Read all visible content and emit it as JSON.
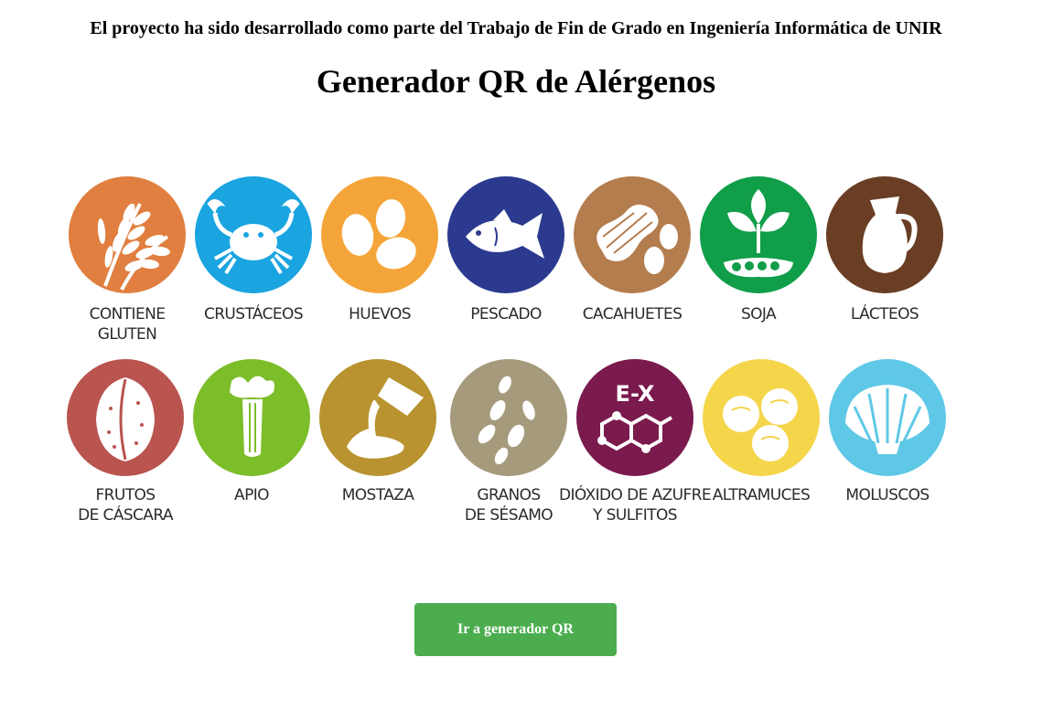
{
  "header": {
    "notice": "El proyecto ha sido desarrollado como parte del Trabajo de Fin de Grado en Ingeniería Informática de UNIR",
    "title": "Generador QR de Alérgenos"
  },
  "allergens": [
    {
      "label": "CONTIENE\nGLUTEN",
      "icon": "wheat-icon",
      "color": "#e07f40"
    },
    {
      "label": "CRUSTÁCEOS",
      "icon": "crab-icon",
      "color": "#1aa4e0"
    },
    {
      "label": "HUEVOS",
      "icon": "eggs-icon",
      "color": "#f4a53a"
    },
    {
      "label": "PESCADO",
      "icon": "fish-icon",
      "color": "#2b3a8f"
    },
    {
      "label": "CACAHUETES",
      "icon": "peanut-icon",
      "color": "#b47d4e"
    },
    {
      "label": "SOJA",
      "icon": "soy-icon",
      "color": "#109e49"
    },
    {
      "label": "LÁCTEOS",
      "icon": "milk-jug-icon",
      "color": "#6a3e24"
    },
    {
      "label": "FRUTOS\nDE CÁSCARA",
      "icon": "walnut-icon",
      "color": "#b9544f"
    },
    {
      "label": "APIO",
      "icon": "celery-icon",
      "color": "#7cbd2a"
    },
    {
      "label": "MOSTAZA",
      "icon": "mustard-icon",
      "color": "#b8932f"
    },
    {
      "label": "GRANOS\nDE SÉSAMO",
      "icon": "sesame-icon",
      "color": "#a69a7c"
    },
    {
      "label": "DIÓXIDO DE AZUFRE\nY SULFITOS",
      "icon": "sulphite-molecule-icon",
      "color": "#7a1a4d"
    },
    {
      "label": "ALTRAMUCES",
      "icon": "lupin-icon",
      "color": "#f5d54a"
    },
    {
      "label": "MOLUSCOS",
      "icon": "shell-icon",
      "color": "#5fc8e6"
    }
  ],
  "sulphite_icon_text": "E-X",
  "button": {
    "label": "Ir a generador QR",
    "color": "#4cad4f"
  }
}
